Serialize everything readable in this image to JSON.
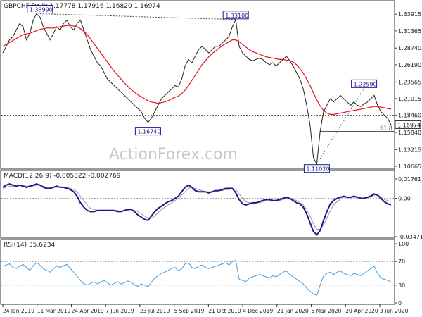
{
  "colors": {
    "price": "#222222",
    "ma": "#e8101a",
    "macd": "#1a1a8c",
    "signal": "#9a9a9a",
    "rsi": "#3da0e0",
    "box_border": "#1a1a8c",
    "grid": "#888888"
  },
  "chart_data": [
    {
      "type": "line",
      "panel": "price",
      "header": "GBPCHF,Daily  1.17778 1.17916 1.16820 1.16974",
      "y_ticks": [
        "1.33915",
        "1.31365",
        "1.28740",
        "1.26190",
        "1.23565",
        "1.21015",
        "1.18460",
        "1.15840",
        "1.13215",
        "1.10665"
      ],
      "ylim": [
        1.1045,
        1.348
      ],
      "x_ticks": [
        "24 Jan 2019",
        "11 Mar 2019",
        "24 Apr 2019",
        "7 Jun 2019",
        "23 Jul 2019",
        "5 Sep 2019",
        "21 Oct 2019",
        "4 Dec 2019",
        "21 Jan 2020",
        "5 Mar 2020",
        "20 Apr 2020",
        "3 Jun 2020"
      ],
      "series": [
        {
          "name": "Close",
          "values": [
            1.28,
            1.29,
            1.3,
            1.305,
            1.315,
            1.325,
            1.32,
            1.3,
            1.31,
            1.33,
            1.34,
            1.335,
            1.32,
            1.31,
            1.3,
            1.31,
            1.32,
            1.315,
            1.325,
            1.33,
            1.32,
            1.315,
            1.325,
            1.33,
            1.315,
            1.3,
            1.285,
            1.275,
            1.265,
            1.26,
            1.25,
            1.24,
            1.235,
            1.23,
            1.225,
            1.22,
            1.215,
            1.21,
            1.205,
            1.2,
            1.195,
            1.19,
            1.18,
            1.174,
            1.18,
            1.19,
            1.2,
            1.21,
            1.215,
            1.22,
            1.225,
            1.23,
            1.228,
            1.24,
            1.26,
            1.27,
            1.265,
            1.275,
            1.285,
            1.29,
            1.285,
            1.28,
            1.285,
            1.29,
            1.29,
            1.295,
            1.3,
            1.305,
            1.32,
            1.331,
            1.29,
            1.28,
            1.275,
            1.27,
            1.268,
            1.27,
            1.272,
            1.27,
            1.265,
            1.262,
            1.265,
            1.26,
            1.265,
            1.27,
            1.275,
            1.268,
            1.26,
            1.25,
            1.24,
            1.225,
            1.2,
            1.17,
            1.12,
            1.11,
            1.16,
            1.19,
            1.2,
            1.21,
            1.205,
            1.21,
            1.215,
            1.21,
            1.205,
            1.2,
            1.205,
            1.2,
            1.198,
            1.202,
            1.205,
            1.21,
            1.215,
            1.2,
            1.19,
            1.185,
            1.18,
            1.17
          ]
        },
        {
          "name": "MA",
          "values": [
            1.29,
            1.293,
            1.296,
            1.299,
            1.302,
            1.305,
            1.308,
            1.309,
            1.31,
            1.312,
            1.314,
            1.316,
            1.317,
            1.318,
            1.318,
            1.318,
            1.319,
            1.32,
            1.321,
            1.322,
            1.322,
            1.321,
            1.32,
            1.317,
            1.313,
            1.308,
            1.301,
            1.294,
            1.287,
            1.28,
            1.273,
            1.266,
            1.259,
            1.252,
            1.246,
            1.24,
            1.234,
            1.229,
            1.224,
            1.22,
            1.216,
            1.213,
            1.21,
            1.207,
            1.205,
            1.204,
            1.203,
            1.204,
            1.205,
            1.207,
            1.21,
            1.212,
            1.214,
            1.218,
            1.223,
            1.23,
            1.238,
            1.246,
            1.254,
            1.262,
            1.268,
            1.274,
            1.279,
            1.283,
            1.287,
            1.291,
            1.294,
            1.297,
            1.3,
            1.3,
            1.297,
            1.293,
            1.289,
            1.285,
            1.282,
            1.28,
            1.278,
            1.276,
            1.274,
            1.273,
            1.272,
            1.271,
            1.27,
            1.27,
            1.269,
            1.268,
            1.266,
            1.262,
            1.256,
            1.249,
            1.24,
            1.23,
            1.219,
            1.208,
            1.199,
            1.192,
            1.188,
            1.186,
            1.186,
            1.187,
            1.188,
            1.189,
            1.19,
            1.191,
            1.192,
            1.193,
            1.194,
            1.195,
            1.196,
            1.197,
            1.198,
            1.198,
            1.197,
            1.196,
            1.195,
            1.194
          ]
        }
      ],
      "current_price_label": "1.16974",
      "annotations": [
        {
          "text": "1.33990",
          "x_index": 11,
          "value": 1.3399
        },
        {
          "text": "1.33100",
          "x_index": 69,
          "value": 1.331
        },
        {
          "text": "1.16740",
          "x_index": 43,
          "value": 1.1674
        },
        {
          "text": "1.11020",
          "x_index": 93,
          "value": 1.1102
        },
        {
          "text": "1.22590",
          "x_index": 107,
          "value": 1.2259
        },
        {
          "text": "61.8",
          "x_index": 115,
          "value": 1.16
        }
      ],
      "horizontal_lines": [
        {
          "value": 1.1846,
          "style": "dotted"
        },
        {
          "value": 1.16974,
          "style": "solid-grey"
        },
        {
          "value": 1.16,
          "style": "solid"
        }
      ],
      "watermark": "ActionForex.com"
    },
    {
      "type": "line",
      "panel": "macd",
      "header": "MACD(12,26,9) -0.005822 -0.002769",
      "y_ticks": [
        "0.017617",
        "0.00",
        "-0.034711"
      ],
      "ylim": [
        -0.0347,
        0.0176
      ],
      "series": [
        {
          "name": "MACD",
          "values": [
            0.01,
            0.012,
            0.013,
            0.012,
            0.011,
            0.012,
            0.011,
            0.01,
            0.011,
            0.012,
            0.013,
            0.012,
            0.01,
            0.009,
            0.009,
            0.01,
            0.011,
            0.01,
            0.01,
            0.009,
            0.008,
            0.006,
            0.002,
            -0.004,
            -0.008,
            -0.011,
            -0.012,
            -0.012,
            -0.011,
            -0.011,
            -0.011,
            -0.011,
            -0.011,
            -0.011,
            -0.012,
            -0.012,
            -0.011,
            -0.01,
            -0.01,
            -0.012,
            -0.015,
            -0.017,
            -0.019,
            -0.02,
            -0.016,
            -0.012,
            -0.009,
            -0.007,
            -0.005,
            -0.003,
            -0.002,
            0.0,
            0.002,
            0.006,
            0.01,
            0.012,
            0.01,
            0.007,
            0.006,
            0.006,
            0.006,
            0.005,
            0.006,
            0.007,
            0.007,
            0.008,
            0.009,
            0.009,
            0.009,
            0.005,
            -0.001,
            -0.005,
            -0.006,
            -0.005,
            -0.004,
            -0.004,
            -0.003,
            -0.002,
            -0.001,
            -0.001,
            -0.002,
            -0.002,
            -0.001,
            0.0,
            0.001,
            0.0,
            -0.002,
            -0.004,
            -0.005,
            -0.008,
            -0.014,
            -0.022,
            -0.03,
            -0.033,
            -0.029,
            -0.02,
            -0.012,
            -0.005,
            -0.002,
            0.0,
            0.001,
            0.002,
            0.001,
            0.001,
            0.002,
            0.001,
            0.0,
            0.0,
            0.001,
            0.002,
            0.004,
            0.003,
            0.0,
            -0.003,
            -0.005,
            -0.0058
          ]
        },
        {
          "name": "Signal",
          "values": [
            0.009,
            0.01,
            0.011,
            0.011,
            0.011,
            0.012,
            0.012,
            0.011,
            0.011,
            0.011,
            0.012,
            0.012,
            0.011,
            0.01,
            0.01,
            0.01,
            0.01,
            0.01,
            0.01,
            0.01,
            0.009,
            0.008,
            0.006,
            0.002,
            -0.002,
            -0.006,
            -0.009,
            -0.01,
            -0.011,
            -0.011,
            -0.011,
            -0.011,
            -0.011,
            -0.011,
            -0.011,
            -0.012,
            -0.011,
            -0.011,
            -0.01,
            -0.011,
            -0.012,
            -0.014,
            -0.016,
            -0.018,
            -0.018,
            -0.016,
            -0.013,
            -0.01,
            -0.008,
            -0.006,
            -0.004,
            -0.002,
            0.0,
            0.003,
            0.006,
            0.009,
            0.01,
            0.009,
            0.008,
            0.007,
            0.006,
            0.006,
            0.006,
            0.006,
            0.007,
            0.007,
            0.008,
            0.008,
            0.009,
            0.008,
            0.004,
            0.0,
            -0.003,
            -0.004,
            -0.004,
            -0.004,
            -0.004,
            -0.003,
            -0.002,
            -0.002,
            -0.002,
            -0.002,
            -0.002,
            -0.001,
            0.0,
            0.0,
            -0.001,
            -0.002,
            -0.004,
            -0.006,
            -0.01,
            -0.016,
            -0.023,
            -0.028,
            -0.028,
            -0.024,
            -0.018,
            -0.011,
            -0.006,
            -0.003,
            -0.001,
            0.001,
            0.001,
            0.001,
            0.001,
            0.001,
            0.001,
            0.0,
            0.001,
            0.001,
            0.003,
            0.003,
            0.001,
            -0.001,
            -0.002,
            -0.0028
          ]
        }
      ]
    },
    {
      "type": "line",
      "panel": "rsi",
      "header": "RSI(14) 35.6234",
      "y_ticks": [
        "100",
        "70",
        "30",
        "0"
      ],
      "ylim": [
        0,
        100
      ],
      "levels": [
        70,
        30
      ],
      "series": [
        {
          "name": "RSI",
          "values": [
            62,
            64,
            66,
            60,
            58,
            62,
            65,
            60,
            55,
            63,
            68,
            64,
            58,
            55,
            52,
            58,
            62,
            60,
            63,
            65,
            58,
            52,
            45,
            38,
            32,
            30,
            33,
            36,
            32,
            35,
            38,
            34,
            30,
            33,
            36,
            32,
            34,
            37,
            35,
            30,
            28,
            32,
            30,
            27,
            35,
            42,
            46,
            50,
            52,
            55,
            58,
            60,
            54,
            58,
            66,
            68,
            60,
            58,
            62,
            64,
            60,
            58,
            60,
            62,
            64,
            66,
            68,
            64,
            70,
            72,
            40,
            38,
            36,
            42,
            44,
            46,
            48,
            46,
            44,
            42,
            46,
            44,
            48,
            52,
            54,
            48,
            44,
            40,
            36,
            32,
            25,
            20,
            15,
            13,
            30,
            46,
            50,
            52,
            48,
            52,
            54,
            50,
            48,
            46,
            50,
            48,
            46,
            50,
            54,
            58,
            62,
            50,
            42,
            40,
            38,
            35.6
          ]
        }
      ]
    }
  ]
}
